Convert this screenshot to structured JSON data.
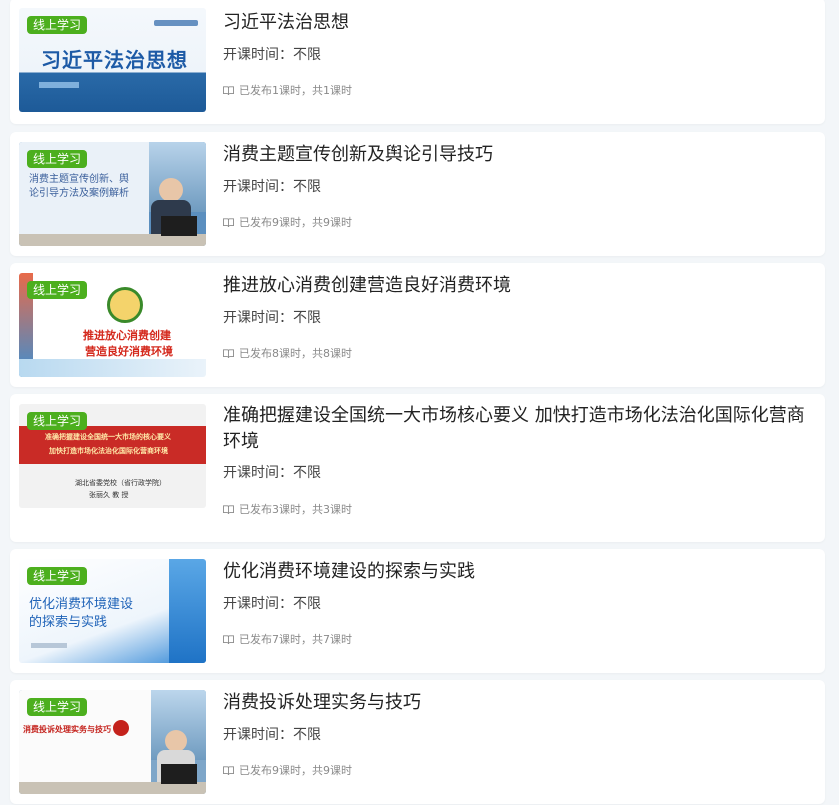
{
  "badge_label": "线上学习",
  "time_label": "开课时间：",
  "courses": [
    {
      "title": "习近平法治思想",
      "time_value": "不限",
      "lessons": "已发布1课时，共1课时",
      "thumb_text": [
        "习近平法治思想"
      ]
    },
    {
      "title": "消费主题宣传创新及舆论引导技巧",
      "time_value": "不限",
      "lessons": "已发布9课时，共9课时",
      "thumb_text": [
        "消费主题宣传创新、舆",
        "论引导方法及案例解析"
      ]
    },
    {
      "title": "推进放心消费创建营造良好消费环境",
      "time_value": "不限",
      "lessons": "已发布8课时，共8课时",
      "thumb_text": [
        "推进放心消费创建",
        "营造良好消费环境"
      ]
    },
    {
      "title": "准确把握建设全国统一大市场核心要义 加快打造市场化法治化国际化营商环境",
      "time_value": "不限",
      "lessons": "已发布3课时，共3课时",
      "thumb_text": [
        "准确把握建设全国统一大市场的核心要义",
        "加快打造市场化法治化国际化营商环境",
        "湖北省委党校（省行政学院）",
        "张丽久  教  授"
      ]
    },
    {
      "title": "优化消费环境建设的探索与实践",
      "time_value": "不限",
      "lessons": "已发布7课时，共7课时",
      "thumb_text": [
        "优化消费环境建设",
        "的探索与实践"
      ]
    },
    {
      "title": "消费投诉处理实务与技巧",
      "time_value": "不限",
      "lessons": "已发布9课时，共9课时",
      "thumb_text": [
        "消费投诉处理实务与技巧"
      ]
    }
  ]
}
